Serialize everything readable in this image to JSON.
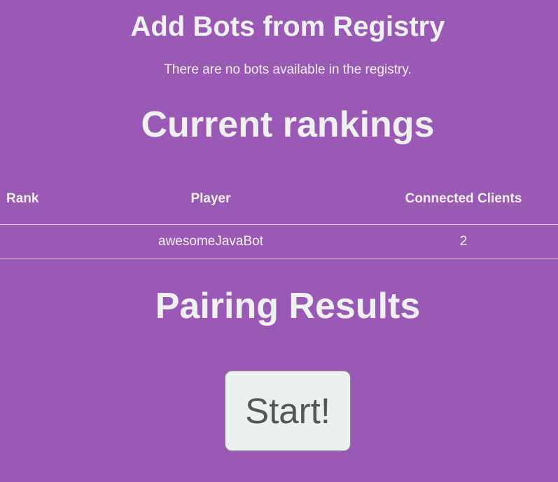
{
  "registry": {
    "title": "Add Bots from Registry",
    "empty_message": "There are no bots available in the registry."
  },
  "rankings": {
    "title": "Current rankings",
    "columns": {
      "rank": "Rank",
      "player": "Player",
      "clients": "Connected Clients"
    },
    "rows": [
      {
        "rank": "",
        "player": "awesomeJavaBot",
        "clients": "2"
      }
    ]
  },
  "pairing": {
    "title": "Pairing Results"
  },
  "start_button": {
    "label": "Start!"
  }
}
